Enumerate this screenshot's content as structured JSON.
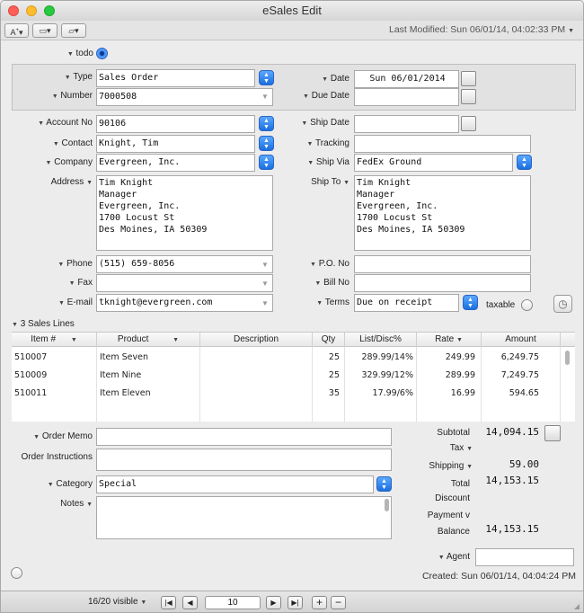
{
  "window": {
    "title": "eSales Edit"
  },
  "toolbar": {
    "last_modified": "Last Modified: Sun 06/01/14, 04:02:33 PM"
  },
  "todo_label": "todo",
  "fields": {
    "type": {
      "label": "Type",
      "value": "Sales Order"
    },
    "number": {
      "label": "Number",
      "value": "7000508"
    },
    "date": {
      "label": "Date",
      "value": "Sun 06/01/2014"
    },
    "due_date": {
      "label": "Due Date",
      "value": ""
    },
    "account_no": {
      "label": "Account No",
      "value": "90106"
    },
    "ship_date": {
      "label": "Ship Date",
      "value": ""
    },
    "contact": {
      "label": "Contact",
      "value": "Knight, Tim"
    },
    "tracking": {
      "label": "Tracking",
      "value": ""
    },
    "company": {
      "label": "Company",
      "value": "Evergreen, Inc."
    },
    "ship_via": {
      "label": "Ship Via",
      "value": "FedEx Ground"
    },
    "address": {
      "label": "Address",
      "value": "Tim Knight\nManager\nEvergreen, Inc.\n1700 Locust St\nDes Moines, IA 50309"
    },
    "ship_to": {
      "label": "Ship To",
      "value": "Tim Knight\nManager\nEvergreen, Inc.\n1700 Locust St\nDes Moines, IA 50309"
    },
    "phone": {
      "label": "Phone",
      "value": "(515) 659-8056"
    },
    "po_no": {
      "label": "P.O. No",
      "value": ""
    },
    "fax": {
      "label": "Fax",
      "value": ""
    },
    "bill_no": {
      "label": "Bill No",
      "value": ""
    },
    "email": {
      "label": "E-mail",
      "value": "tknight@evergreen.com"
    },
    "terms": {
      "label": "Terms",
      "value": "Due on receipt"
    },
    "taxable_label": "taxable"
  },
  "sales_lines": {
    "header": "3 Sales Lines",
    "columns": [
      "Item #",
      "Product",
      "Description",
      "Qty",
      "List/Disc%",
      "Rate",
      "Amount"
    ],
    "rows": [
      {
        "item": "510007",
        "product": "Item Seven",
        "description": "",
        "qty": "25",
        "list": "289.99/14%",
        "rate": "249.99",
        "amount": "6,249.75"
      },
      {
        "item": "510009",
        "product": "Item Nine",
        "description": "",
        "qty": "25",
        "list": "329.99/12%",
        "rate": "289.99",
        "amount": "7,249.75"
      },
      {
        "item": "510011",
        "product": "Item Eleven",
        "description": "",
        "qty": "35",
        "list": "17.99/6%",
        "rate": "16.99",
        "amount": "594.65"
      }
    ]
  },
  "bottom": {
    "order_memo": {
      "label": "Order Memo",
      "value": ""
    },
    "order_instructions": {
      "label": "Order Instructions",
      "value": ""
    },
    "category": {
      "label": "Category",
      "value": "Special"
    },
    "notes": {
      "label": "Notes",
      "value": ""
    }
  },
  "totals": {
    "subtotal_label": "Subtotal",
    "subtotal": "14,094.15",
    "tax_label": "Tax",
    "tax": "",
    "shipping_label": "Shipping",
    "shipping": "59.00",
    "total_label": "Total",
    "total": "14,153.15",
    "discount_label": "Discount",
    "payment_label": "Payment v",
    "balance_label": "Balance",
    "balance": "14,153.15"
  },
  "agent_label": "Agent",
  "agent_value": "",
  "created": "Created: Sun 06/01/14, 04:04:24 PM",
  "footer": {
    "visible": "16/20 visible",
    "record": "10"
  }
}
